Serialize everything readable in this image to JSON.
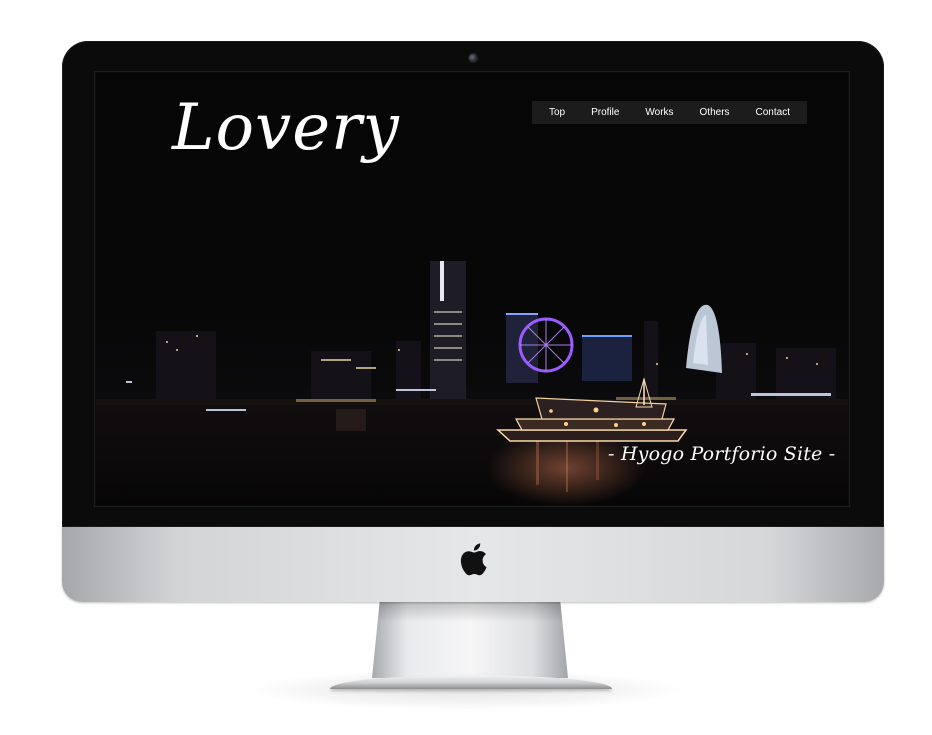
{
  "site": {
    "logo": "Lovery",
    "tagline": "- Hyogo Portforio Site -"
  },
  "nav": {
    "items": [
      {
        "label": "Top"
      },
      {
        "label": "Profile"
      },
      {
        "label": "Works"
      },
      {
        "label": "Others"
      },
      {
        "label": "Contact"
      }
    ]
  },
  "icons": {
    "brand": "apple-icon",
    "camera": "webcam-icon"
  },
  "colors": {
    "screen_bg": "#060606",
    "nav_bg": "#1c1c1c",
    "text": "#ffffff",
    "ferris_wheel": "#9a5cff"
  }
}
